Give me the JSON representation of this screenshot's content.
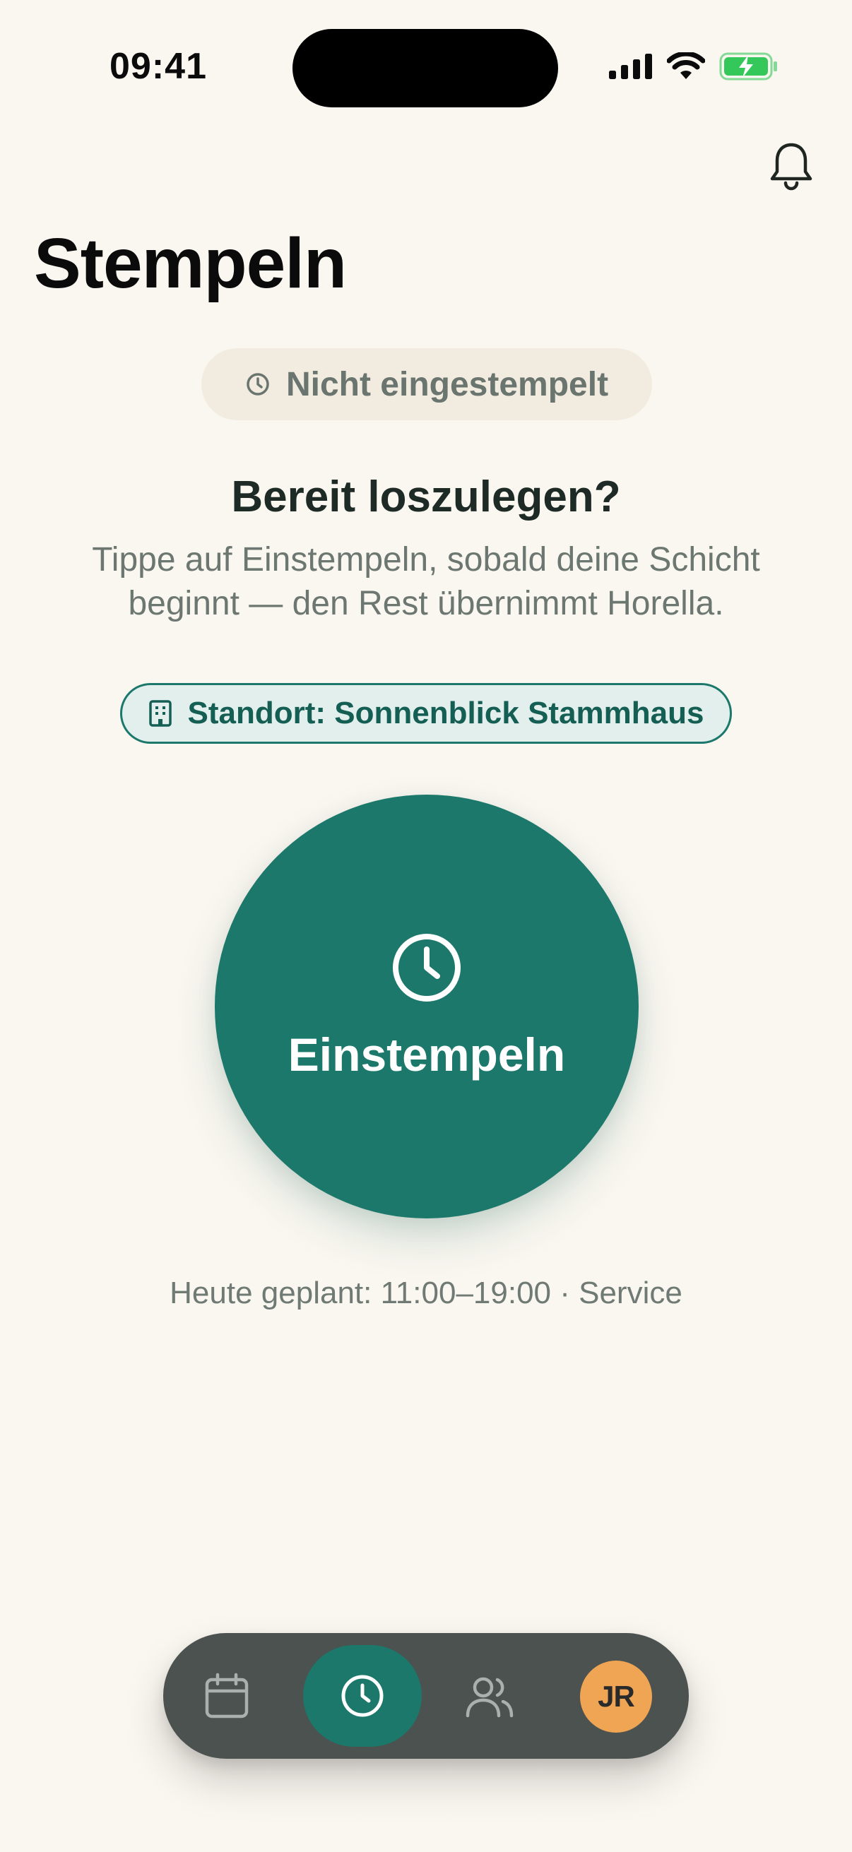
{
  "status_bar": {
    "time": "09:41"
  },
  "header": {
    "title": "Stempeln"
  },
  "status_pill": {
    "label": "Nicht eingestempelt"
  },
  "ready": {
    "heading": "Bereit loszulegen?",
    "subtitle_line1": "Tippe auf Einstempeln, sobald deine Schicht",
    "subtitle_line2": "beginnt — den Rest übernimmt Horella."
  },
  "location": {
    "label": "Standort: Sonnenblick Stammhaus"
  },
  "clock_in": {
    "label": "Einstempeln"
  },
  "schedule": {
    "text": "Heute geplant: 11:00–19:00 · Service"
  },
  "tabbar": {
    "profile_initials": "JR"
  },
  "colors": {
    "background": "#faf6f0",
    "accent": "#1b786b",
    "tabbar": "#4b524f",
    "avatar": "#f0a555",
    "battery": "#34c759"
  }
}
